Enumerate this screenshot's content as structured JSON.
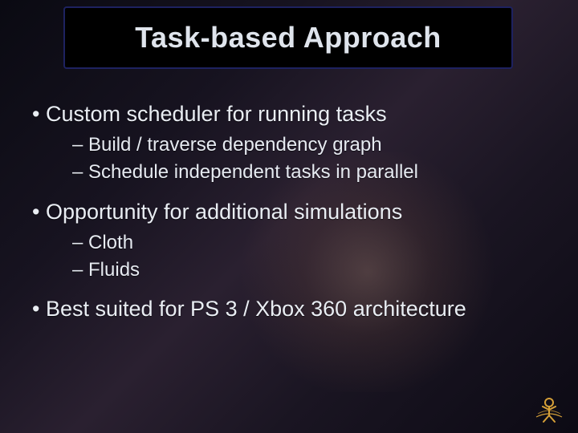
{
  "title": "Task-based Approach",
  "bullets": [
    {
      "text": "Custom scheduler for running tasks",
      "sub": [
        "Build / traverse dependency graph",
        "Schedule independent tasks in parallel"
      ]
    },
    {
      "text": "Opportunity for additional simulations",
      "sub": [
        "Cloth",
        "Fluids"
      ]
    },
    {
      "text": "Best suited for PS 3 / Xbox 360 architecture",
      "sub": []
    }
  ]
}
